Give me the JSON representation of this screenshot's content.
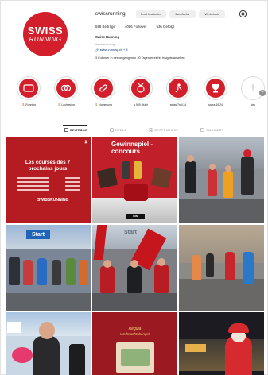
{
  "profile": {
    "avatar_line1": "SWISS",
    "avatar_line2": "RUNNING",
    "username": "swissrunning",
    "edit_button": "Profil bearbeiten",
    "archive_button": "Zum Archiv",
    "tools_button": "Werbetools",
    "posts_count": "598 Beiträge",
    "followers_count": "4086 Follower",
    "following_count": "536 Gefolgt",
    "display_name": "Swiss Running",
    "tag": "#swissrunning",
    "link": "🔗 swiss-running.ch + 3",
    "insights": "3 Follower in der vergangenen 30 Tagen erreicht. Insights ansehen"
  },
  "highlights": [
    {
      "label": "🏃 Running"
    },
    {
      "label": "🏃 Laufsaving"
    },
    {
      "label": "🏃 Nomenung"
    },
    {
      "label": "● 599 Mulet"
    },
    {
      "label": "swiss Trail 24"
    },
    {
      "label": "swiss 60 24"
    },
    {
      "label": "Neu"
    }
  ],
  "tabs": [
    {
      "label": "BEITRÄGE",
      "active": true
    },
    {
      "label": "REELS",
      "active": false
    },
    {
      "label": "GESPEICHERT",
      "active": false
    },
    {
      "label": "MARKIERT",
      "active": false
    }
  ],
  "posts": {
    "tile1_title": "Les courses des 7 prochains jours",
    "tile1_logo": "SWISSRUNNING",
    "tile2_title": "Gewinnspiel - concours",
    "tile2_subtitle": "WIN",
    "tile3_banner": "Start",
    "tile4_banner": "Start",
    "tile8_title": "Regula",
    "tile8_subtitle": "Weihnachtsbengel"
  },
  "colors": {
    "brand_red": "#d31f2b",
    "text": "#262626",
    "muted": "#8e8e8e",
    "link": "#00376b"
  }
}
